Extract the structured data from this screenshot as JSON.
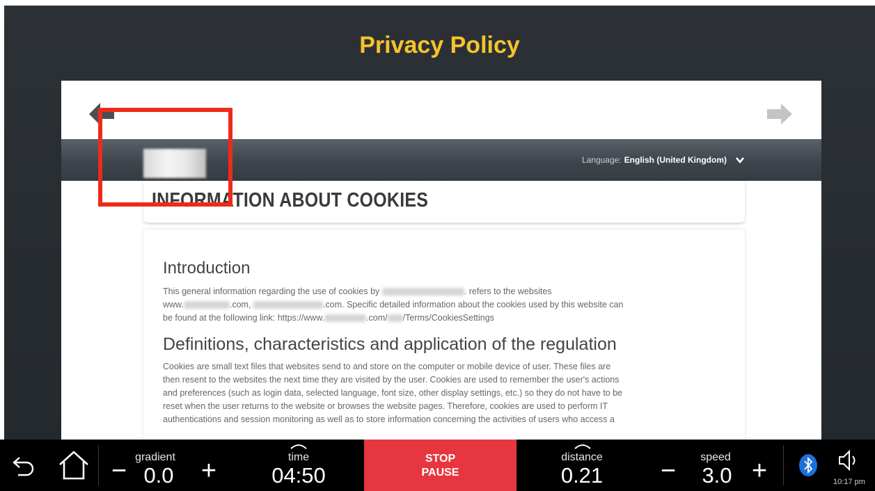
{
  "app": {
    "title": "Privacy Policy"
  },
  "site": {
    "language_label": "Language:",
    "language_value": "English (United Kingdom)",
    "heading": "INFORMATION ABOUT COOKIES",
    "intro_heading": "Introduction",
    "intro_p1_a": "This general information regarding the use of cookies by",
    "intro_p1_b": ". refers to the websites",
    "intro_p2_a": "www.",
    "intro_p2_b": ".com,",
    "intro_p2_c": ".com. Specific detailed information about the cookies used by this website can",
    "intro_p3_a": "be found at the following link: https://www.",
    "intro_p3_b": ".com/",
    "intro_p3_c": "/Terms/CookiesSettings",
    "defs_heading": "Definitions, characteristics and application of the regulation",
    "defs_p1": "Cookies are small text files that websites send to and store on the computer or mobile device of user. These files are",
    "defs_p2": "then resent to the websites the next time they are visited by the user. Cookies are used to remember the user's actions",
    "defs_p3": "and preferences (such as login data, selected language, font size, other display settings, etc.) so they do not have to be",
    "defs_p4": "reset when the user returns to the website or browses the website pages. Therefore, cookies are used to perform IT",
    "defs_p5": "authentications and session monitoring as well as to store information concerning the activities of users who access a"
  },
  "controls": {
    "gradient": {
      "label": "gradient",
      "value": "0.0"
    },
    "time": {
      "label": "time",
      "value": "04:50"
    },
    "stop_label": "STOP",
    "pause_label": "PAUSE",
    "distance": {
      "label": "distance",
      "value": "0.21"
    },
    "speed": {
      "label": "speed",
      "value": "3.0"
    },
    "minus": "−",
    "plus": "+",
    "clock": "10:17 pm"
  },
  "colors": {
    "title": "#f6c428",
    "stop_button": "#e63740",
    "highlight": "#ee2a1c"
  },
  "icons": [
    "back-icon",
    "home-icon",
    "arrow-left-icon",
    "arrow-right-icon",
    "chevron-down-icon",
    "caret-up-icon",
    "bluetooth-icon",
    "volume-icon"
  ]
}
